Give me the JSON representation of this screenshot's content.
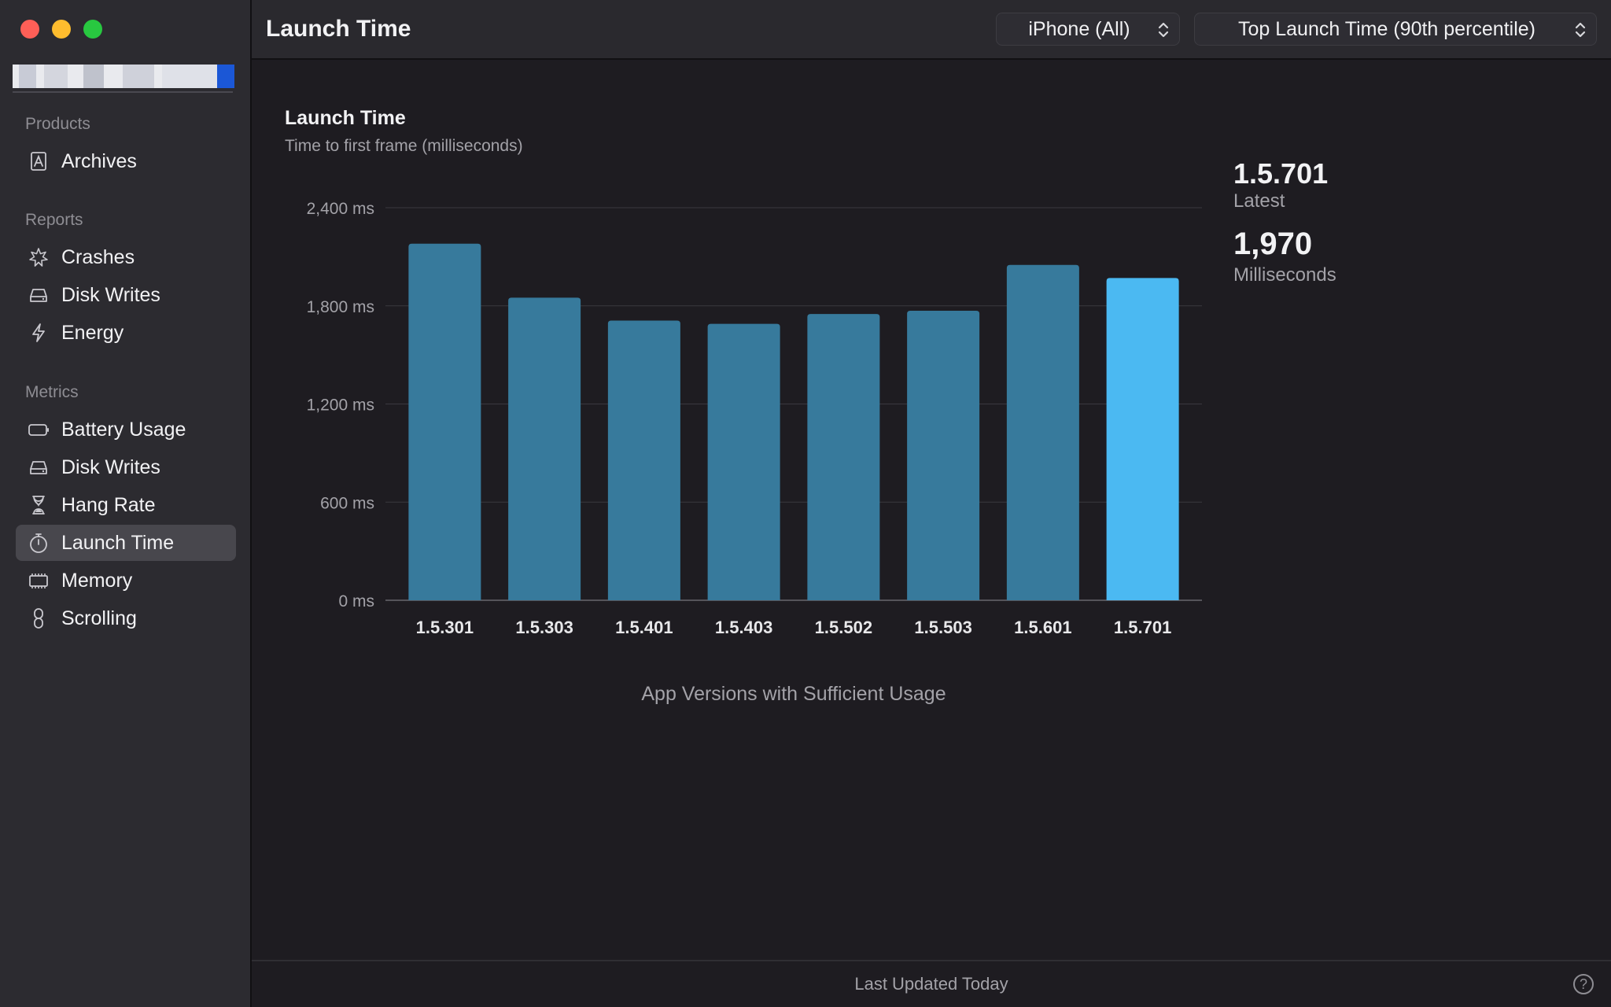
{
  "sidebar": {
    "sections": [
      {
        "label": "Products",
        "items": [
          {
            "label": "Archives",
            "icon": "archive-icon",
            "selected": false
          }
        ]
      },
      {
        "label": "Reports",
        "items": [
          {
            "label": "Crashes",
            "icon": "crash-icon",
            "selected": false
          },
          {
            "label": "Disk Writes",
            "icon": "disk-icon",
            "selected": false
          },
          {
            "label": "Energy",
            "icon": "energy-icon",
            "selected": false
          }
        ]
      },
      {
        "label": "Metrics",
        "items": [
          {
            "label": "Battery Usage",
            "icon": "battery-icon",
            "selected": false
          },
          {
            "label": "Disk Writes",
            "icon": "disk-icon",
            "selected": false
          },
          {
            "label": "Hang Rate",
            "icon": "hourglass-icon",
            "selected": false
          },
          {
            "label": "Launch Time",
            "icon": "stopwatch-icon",
            "selected": true
          },
          {
            "label": "Memory",
            "icon": "memory-icon",
            "selected": false
          },
          {
            "label": "Scrolling",
            "icon": "scrolling-icon",
            "selected": false
          }
        ]
      }
    ]
  },
  "toolbar": {
    "title": "Launch Time",
    "device_selector": "iPhone (All)",
    "metric_selector": "Top Launch Time (90th percentile)"
  },
  "chart_data": {
    "type": "bar",
    "title": "Launch Time",
    "subtitle": "Time to first frame (milliseconds)",
    "xlabel": "App Versions with Sufficient Usage",
    "ylabel": "",
    "categories": [
      "1.5.301",
      "1.5.303",
      "1.5.401",
      "1.5.403",
      "1.5.502",
      "1.5.503",
      "1.5.601",
      "1.5.701"
    ],
    "values": [
      2180,
      1850,
      1710,
      1690,
      1750,
      1770,
      2050,
      1970
    ],
    "ylim": [
      0,
      2400
    ],
    "yticks": [
      0,
      600,
      1200,
      1800,
      2400
    ],
    "ytick_labels": [
      "0 ms",
      "600 ms",
      "1,200 ms",
      "1,800 ms",
      "2,400 ms"
    ],
    "grid": true,
    "highlight_index": 7,
    "colors": {
      "bar": "#377a9c",
      "highlight": "#4bb9f2",
      "grid": "#3a393f"
    }
  },
  "summary": {
    "version": "1.5.701",
    "version_label": "Latest",
    "value": "1,970",
    "value_label": "Milliseconds"
  },
  "footer": {
    "status": "Last Updated Today",
    "help_symbol": "?"
  }
}
